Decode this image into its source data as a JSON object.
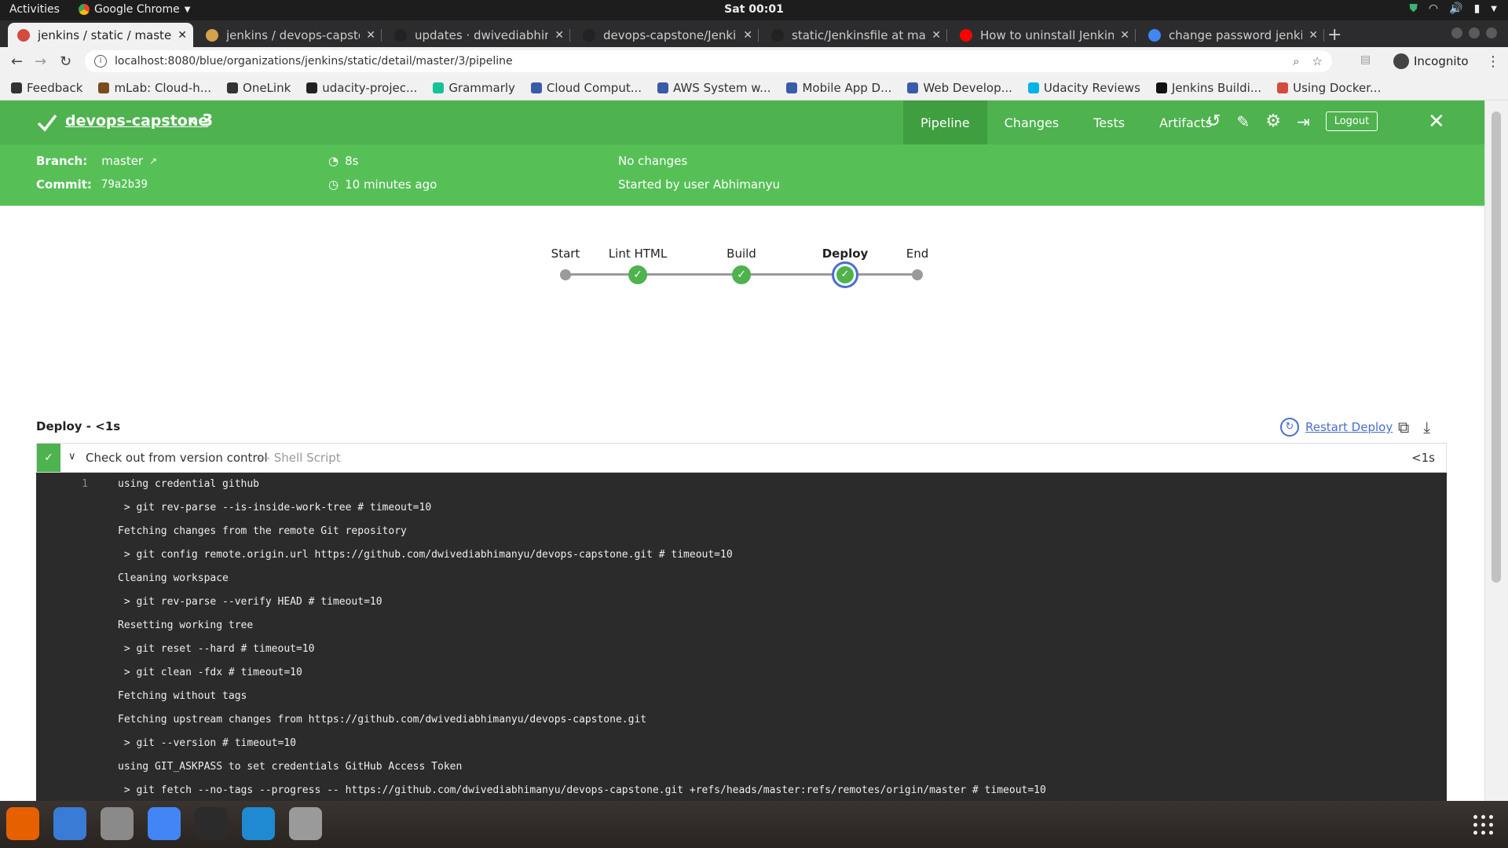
{
  "system": {
    "activities": "Activities",
    "app_name": "Google Chrome",
    "clock": "Sat 00:01"
  },
  "browser": {
    "tabs": [
      {
        "title": "jenkins / static / master / ",
        "active": true,
        "favicon_color": "#d34b3f"
      },
      {
        "title": "jenkins / devops-capstone",
        "active": false,
        "favicon_color": "#d3a24b"
      },
      {
        "title": "updates · dwivediabhimanyu",
        "active": false,
        "favicon_color": "#222222"
      },
      {
        "title": "devops-capstone/Jenkinsfile",
        "active": false,
        "favicon_color": "#222222"
      },
      {
        "title": "static/Jenkinsfile at master",
        "active": false,
        "favicon_color": "#222222"
      },
      {
        "title": "How to uninstall Jenkins",
        "active": false,
        "favicon_color": "#ff0000"
      },
      {
        "title": "change password jenkins",
        "active": false,
        "favicon_color": "#4285f4"
      }
    ],
    "url": "localhost:8080/blue/organizations/jenkins/static/detail/master/3/pipeline",
    "incognito_label": "Incognito",
    "bookmarks": [
      {
        "label": "Feedback",
        "color": "#333333"
      },
      {
        "label": "mLab: Cloud-h...",
        "color": "#7a4b1e"
      },
      {
        "label": "OneLink",
        "color": "#333333"
      },
      {
        "label": "udacity-projec...",
        "color": "#222222"
      },
      {
        "label": "Grammarly",
        "color": "#15c39a"
      },
      {
        "label": "Cloud Comput...",
        "color": "#3a5ba9"
      },
      {
        "label": "AWS System w...",
        "color": "#3a5ba9"
      },
      {
        "label": "Mobile App D...",
        "color": "#3a5ba9"
      },
      {
        "label": "Web Develop...",
        "color": "#3a5ba9"
      },
      {
        "label": "Udacity Reviews",
        "color": "#02b3e4"
      },
      {
        "label": "Jenkins Buildi...",
        "color": "#111111"
      },
      {
        "label": "Using Docker...",
        "color": "#d34b3f"
      }
    ]
  },
  "jenkins": {
    "pipeline_name": "devops-capstone",
    "run_number": "3",
    "nav_tabs": [
      "Pipeline",
      "Changes",
      "Tests",
      "Artifacts"
    ],
    "active_tab": "Pipeline",
    "logout_label": "Logout",
    "branch_label": "Branch:",
    "branch_value": "master",
    "commit_label": "Commit:",
    "commit_value": "79a2b39",
    "duration": "8s",
    "time_ago": "10 minutes ago",
    "changes": "No changes",
    "started_by": "Started by user Abhimanyu",
    "colors": {
      "header": "#4eb24f",
      "subheader": "#56c057",
      "selected_ring": "#4a6ecf"
    }
  },
  "graph": {
    "stages": [
      {
        "label": "Start",
        "state": "plain"
      },
      {
        "label": "Lint HTML",
        "state": "success"
      },
      {
        "label": "Build",
        "state": "success"
      },
      {
        "label": "Deploy",
        "state": "success-selected"
      },
      {
        "label": "End",
        "state": "plain"
      }
    ]
  },
  "step": {
    "stage_title": "Deploy - <1s",
    "restart_label": "Restart Deploy",
    "name": "Check out from version control",
    "type": "— Shell Script",
    "duration": "<1s",
    "log": [
      {
        "num": "1",
        "text": "using credential github"
      },
      {
        "num": "",
        "text": " > git rev-parse --is-inside-work-tree # timeout=10"
      },
      {
        "num": "",
        "text": "Fetching changes from the remote Git repository"
      },
      {
        "num": "",
        "text": " > git config remote.origin.url https://github.com/dwivediabhimanyu/devops-capstone.git # timeout=10"
      },
      {
        "num": "",
        "text": "Cleaning workspace"
      },
      {
        "num": "",
        "text": " > git rev-parse --verify HEAD # timeout=10"
      },
      {
        "num": "",
        "text": "Resetting working tree"
      },
      {
        "num": "",
        "text": " > git reset --hard # timeout=10"
      },
      {
        "num": "",
        "text": " > git clean -fdx # timeout=10"
      },
      {
        "num": "",
        "text": "Fetching without tags"
      },
      {
        "num": "",
        "text": "Fetching upstream changes from https://github.com/dwivediabhimanyu/devops-capstone.git"
      },
      {
        "num": "",
        "text": " > git --version # timeout=10"
      },
      {
        "num": "",
        "text": "using GIT_ASKPASS to set credentials GitHub Access Token"
      },
      {
        "num": "",
        "text": " > git fetch --no-tags --progress -- https://github.com/dwivediabhimanyu/devops-capstone.git +refs/heads/master:refs/remotes/origin/master # timeout=10"
      }
    ]
  },
  "dock": {
    "apps": [
      {
        "name": "firefox-icon",
        "color": "#e66000"
      },
      {
        "name": "thunderbird-icon",
        "color": "#3a7bd5"
      },
      {
        "name": "files-icon",
        "color": "#8a8a8a"
      },
      {
        "name": "chrome-icon",
        "color": "#4285f4"
      },
      {
        "name": "terminal-icon",
        "color": "#2b2b2b"
      },
      {
        "name": "vscode-icon",
        "color": "#1f8ad2"
      },
      {
        "name": "printer-icon",
        "color": "#9a9a9a"
      }
    ]
  }
}
